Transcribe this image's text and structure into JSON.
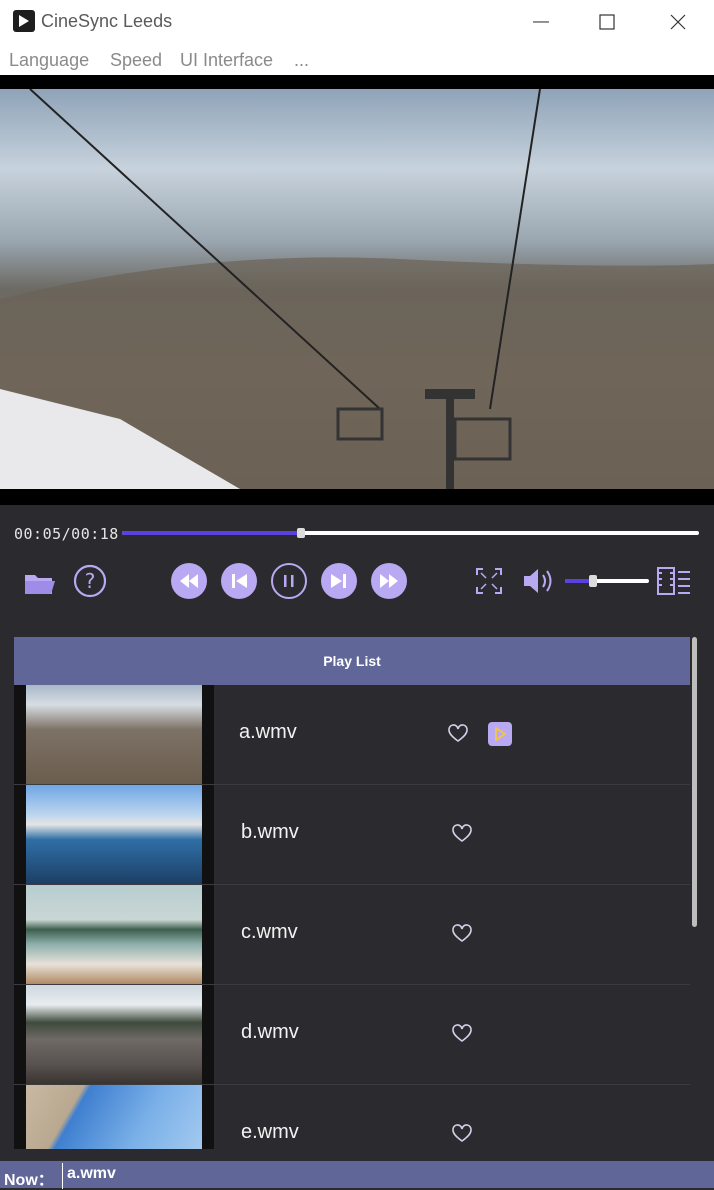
{
  "window": {
    "title": "CineSync Leeds",
    "minimize_icon": "minimize-icon",
    "maximize_icon": "maximize-icon",
    "close_icon": "close-icon"
  },
  "menu": [
    "Language",
    "Speed",
    "UI Interface",
    "..."
  ],
  "player": {
    "time_display": "00:05/00:18",
    "progress_fraction": 0.31,
    "volume_fraction": 0.33,
    "accent_color": "#5b3fe0",
    "button_color": "#b9a9f2",
    "icons": [
      "open-folder-icon",
      "help-icon",
      "rewind-icon",
      "previous-icon",
      "pause-icon",
      "next-icon",
      "fast-forward-icon",
      "fullscreen-icon",
      "volume-icon",
      "playlist-toggle-icon"
    ]
  },
  "playlist": {
    "header": "Play List",
    "items": [
      {
        "name": "a.wmv",
        "current": true
      },
      {
        "name": "b.wmv",
        "current": false
      },
      {
        "name": "c.wmv",
        "current": false
      },
      {
        "name": "d.wmv",
        "current": false
      },
      {
        "name": "e.wmv",
        "current": false
      }
    ]
  },
  "status": {
    "label": "Now：",
    "value": "a.wmv"
  }
}
